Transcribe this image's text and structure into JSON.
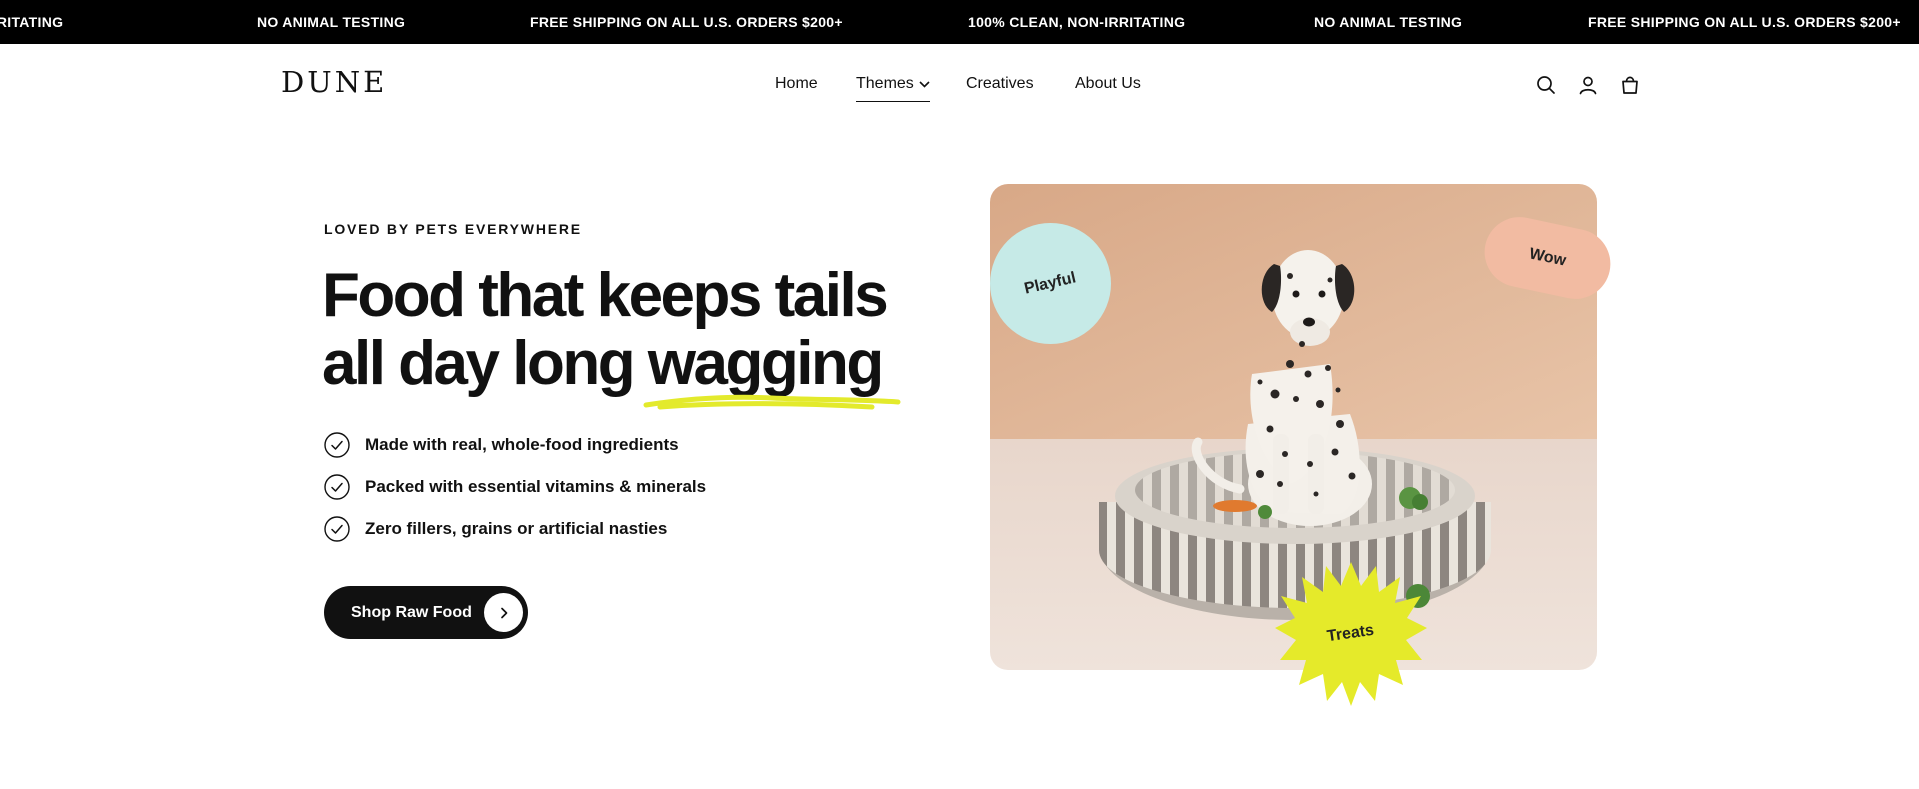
{
  "announcement": {
    "items": [
      "100% CLEAN, NON-IRRITATING",
      "NO ANIMAL TESTING",
      "FREE SHIPPING ON ALL U.S. ORDERS $200+",
      "100% CLEAN, NON-IRRITATING",
      "NO ANIMAL TESTING",
      "FREE SHIPPING ON ALL U.S. ORDERS $200+"
    ]
  },
  "header": {
    "logo": "DUNE",
    "nav": [
      "Home",
      "Themes",
      "Creatives",
      "About Us"
    ],
    "icons": [
      "search-icon",
      "account-icon",
      "cart-icon"
    ]
  },
  "hero": {
    "eyebrow": "LOVED BY PETS EVERYWHERE",
    "headline_line1": "Food that keeps tails",
    "headline_line2_start": "all day long",
    "headline_highlight": "wagging",
    "features": [
      "Made with real, whole-food ingredients",
      "Packed with essential vitamins & minerals",
      "Zero fillers, grains or artificial nasties"
    ],
    "cta_label": "Shop Raw Food",
    "badges": {
      "playful": "Playful",
      "wow": "Wow",
      "treats": "Treats"
    }
  },
  "colors": {
    "announcement_bg": "#000000",
    "text": "#111111",
    "highlight_underline": "#e3ea2c",
    "badge_playful": "#c6eae7",
    "badge_wow": "#f2bba2",
    "badge_treats": "#e5ea2a",
    "image_wall": "#e0b595",
    "image_floor": "#ecdcd3"
  }
}
